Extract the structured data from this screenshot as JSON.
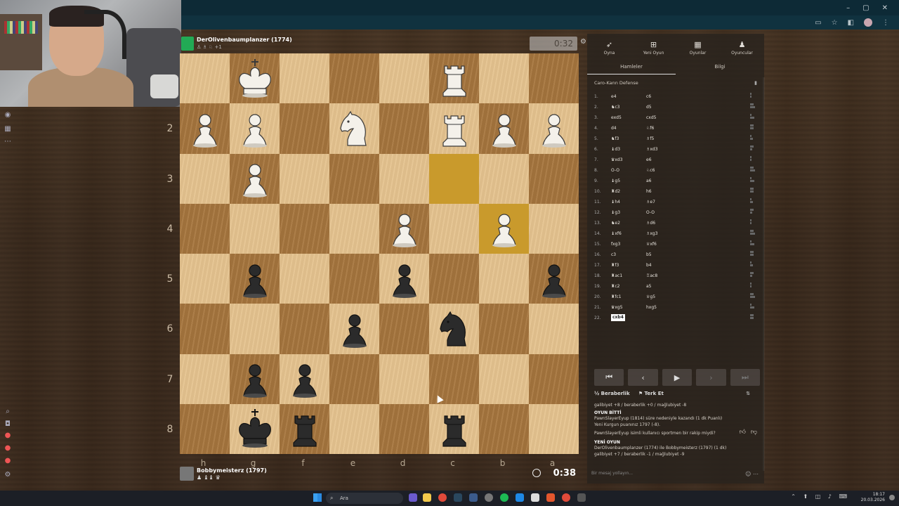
{
  "window": {
    "controls": [
      "–",
      "▢",
      "✕"
    ]
  },
  "top_player": {
    "name": "DerOlivenbaumplanzer (1774)",
    "material": "♙ ♗ ♘ +1",
    "clock": "0:32"
  },
  "bottom_player": {
    "name": "Bobbymeisterz (1797)",
    "material": "♟ ♝♝ ♛",
    "clock": "0:38"
  },
  "board": {
    "orientation": "black",
    "files": [
      "h",
      "g",
      "f",
      "e",
      "d",
      "c",
      "b",
      "a"
    ],
    "ranks": [
      "1",
      "2",
      "3",
      "4",
      "5",
      "6",
      "7",
      "8"
    ],
    "highlight_squares": [
      "c3",
      "b4"
    ],
    "pieces": [
      {
        "sq": "g1",
        "type": "king",
        "color": "white"
      },
      {
        "sq": "c1",
        "type": "rook",
        "color": "white"
      },
      {
        "sq": "h2",
        "type": "pawn",
        "color": "white"
      },
      {
        "sq": "g2",
        "type": "pawn",
        "color": "white"
      },
      {
        "sq": "e2",
        "type": "knight",
        "color": "white"
      },
      {
        "sq": "c2",
        "type": "rook",
        "color": "white"
      },
      {
        "sq": "b2",
        "type": "pawn",
        "color": "white"
      },
      {
        "sq": "a2",
        "type": "pawn",
        "color": "white"
      },
      {
        "sq": "g3",
        "type": "pawn",
        "color": "white"
      },
      {
        "sq": "d4",
        "type": "pawn",
        "color": "white"
      },
      {
        "sq": "b4",
        "type": "pawn",
        "color": "white"
      },
      {
        "sq": "g5",
        "type": "pawn",
        "color": "black"
      },
      {
        "sq": "d5",
        "type": "pawn",
        "color": "black"
      },
      {
        "sq": "a5",
        "type": "pawn",
        "color": "black"
      },
      {
        "sq": "e6",
        "type": "pawn",
        "color": "black"
      },
      {
        "sq": "c6",
        "type": "knight",
        "color": "black"
      },
      {
        "sq": "g7",
        "type": "pawn",
        "color": "black"
      },
      {
        "sq": "f7",
        "type": "pawn",
        "color": "black"
      },
      {
        "sq": "g8",
        "type": "king",
        "color": "black"
      },
      {
        "sq": "f8",
        "type": "rook",
        "color": "black"
      },
      {
        "sq": "c8",
        "type": "rook",
        "color": "black"
      }
    ]
  },
  "nav": {
    "items": [
      {
        "label": "Oyna",
        "icon": "rocket-icon"
      },
      {
        "label": "Yeni Oyun",
        "icon": "plus-icon"
      },
      {
        "label": "Oyunlar",
        "icon": "grid-icon"
      },
      {
        "label": "Oyuncular",
        "icon": "players-icon"
      }
    ]
  },
  "tabs": [
    "Hamleler",
    "Bilgi"
  ],
  "opening": "Caro-Kann Defense",
  "moves": [
    {
      "n": "1.",
      "w": "e4",
      "b": "c6"
    },
    {
      "n": "2.",
      "w": "♞c3",
      "b": "d5"
    },
    {
      "n": "3.",
      "w": "exd5",
      "b": "cxd5"
    },
    {
      "n": "4.",
      "w": "d4",
      "b": "♘f6"
    },
    {
      "n": "5.",
      "w": "♞f3",
      "b": "♗f5"
    },
    {
      "n": "6.",
      "w": "♝d3",
      "b": "♗xd3"
    },
    {
      "n": "7.",
      "w": "♛xd3",
      "b": "e6"
    },
    {
      "n": "8.",
      "w": "O-O",
      "b": "♘c6"
    },
    {
      "n": "9.",
      "w": "♝g5",
      "b": "a6"
    },
    {
      "n": "10.",
      "w": "♜d2",
      "b": "h6"
    },
    {
      "n": "11.",
      "w": "♝h4",
      "b": "♗e7"
    },
    {
      "n": "12.",
      "w": "♝g3",
      "b": "O-O"
    },
    {
      "n": "13.",
      "w": "♞e2",
      "b": "♗d6"
    },
    {
      "n": "14.",
      "w": "♝xf6",
      "b": "♗xg3"
    },
    {
      "n": "15.",
      "w": "fxg3",
      "b": "♕xf6"
    },
    {
      "n": "16.",
      "w": "c3",
      "b": "b5"
    },
    {
      "n": "17.",
      "w": "♜f3",
      "b": "b4"
    },
    {
      "n": "18.",
      "w": "♜ac1",
      "b": "♖ac8"
    },
    {
      "n": "19.",
      "w": "♜c2",
      "b": "a5"
    },
    {
      "n": "20.",
      "w": "♜fc1",
      "b": "♕g5"
    },
    {
      "n": "21.",
      "w": "♛xg5",
      "b": "hxg5"
    },
    {
      "n": "22.",
      "w": "cxb4",
      "b": ""
    }
  ],
  "controls": [
    "⏮",
    "‹",
    "▶",
    "›",
    "⏭"
  ],
  "actions": {
    "draw": "½ Beraberlik",
    "resign": "⚑ Terk Et"
  },
  "chat": {
    "line1": "galibiyet +8 / beraberlik +0 / mağlubiyet -8",
    "header1": "OYUN BİTTİ",
    "line2": "PawnSlayerEyup (1814) süre nedeniyle kazandı (1 dk Puanlı)",
    "line3": "Yeni Kurgun puanınız 1797 (-8).",
    "line4": "PawnSlayerEyup isimli kullanıcı sportmen bir rakip miydi?",
    "header2": "YENİ OYUN",
    "line5": "DerOlivenbaumplanzer (1774) ile Bobbymeisterz (1797) (1 dk)",
    "line6": "galibiyet +7 / beraberlik -1 / mağlubiyet -9",
    "input_placeholder": "Bir mesaj yollayın..."
  },
  "taskbar": {
    "search": "Ara",
    "time": "18:17",
    "date": "20.03.2026"
  },
  "colors": {
    "light_square": "#e4c28e",
    "dark_square": "#a8773f",
    "highlight": "#c99a2c",
    "panel_bg": "#28221e"
  }
}
